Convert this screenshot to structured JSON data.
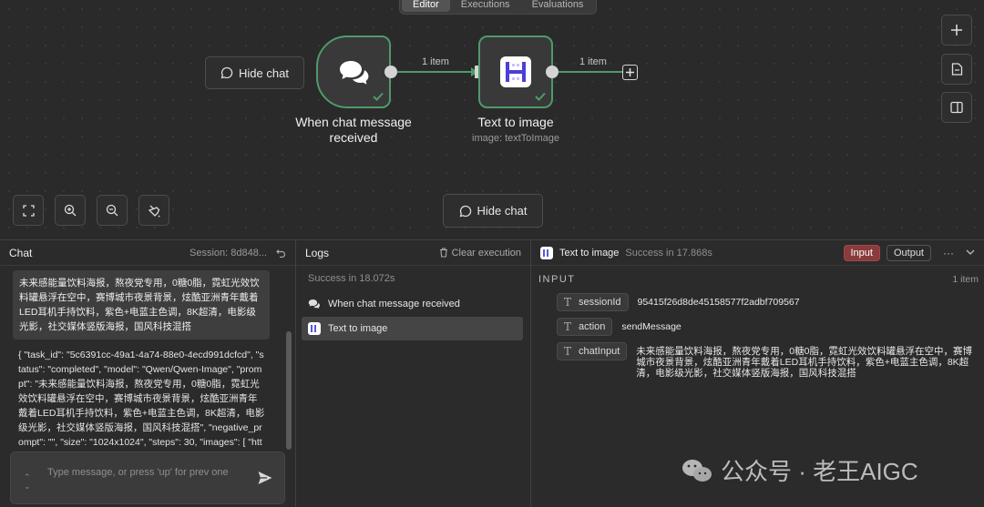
{
  "tabs": [
    "Editor",
    "Executions",
    "Evaluations"
  ],
  "canvas": {
    "hide_chat_label": "Hide chat",
    "nodes": {
      "chat_trigger": {
        "label_line1": "When chat message",
        "label_line2": "received"
      },
      "text_to_image": {
        "label": "Text to image",
        "sub": "image: textToImage"
      }
    },
    "edges": {
      "e1": "1 item",
      "e2": "1 item"
    }
  },
  "chat": {
    "title": "Chat",
    "session": "Session: 8d848...",
    "user_message": "未来感能量饮料海报，熬夜党专用，0糖0脂，霓虹光效饮料罐悬浮在空中，赛博城市夜景背景，炫酷亚洲青年戴着LED耳机手持饮料，紫色+电蓝主色调，8K超清，电影级光影，社交媒体竖版海报，国风科技混搭",
    "response": "{ \"task_id\": \"5c6391cc-49a1-4a74-88e0-4ecd991dcfcd\", \"status\": \"completed\", \"model\": \"Qwen/Qwen-Image\", \"prompt\": \"未来感能量饮料海报，熬夜党专用，0糖0脂，霓虹光效饮料罐悬浮在空中，赛博城市夜景背景，炫酷亚洲青年戴着LED耳机手持饮料，紫色+电蓝主色调，8K超清，电影级光影，社交媒体竖版海报，国风科技混搭\", \"negative_prompt\": \"\", \"size\": \"1024x1024\", \"steps\": 30, \"images\": [ \"http",
    "input_placeholder": "Type message, or press 'up' for prev one"
  },
  "logs": {
    "title": "Logs",
    "clear_label": "Clear execution",
    "status": "Success in 18.072s",
    "items": [
      "When chat message received",
      "Text to image"
    ]
  },
  "detail": {
    "title": "Text to image",
    "status": "Success in 17.868s",
    "input_btn": "Input",
    "output_btn": "Output",
    "section": "INPUT",
    "count": "1 item",
    "params": [
      {
        "key": "sessionId",
        "value": "95415f26d8de45158577f2adbf709567"
      },
      {
        "key": "action",
        "value": "sendMessage"
      },
      {
        "key": "chatInput",
        "value": "未来感能量饮料海报，熬夜党专用，0糖0脂，霓虹光效饮料罐悬浮在空中，赛博城市夜景背景，炫酷亚洲青年戴着LED耳机手持饮料，紫色+电蓝主色调，8K超清，电影级光影，社交媒体竖版海报，国风科技混搭"
      }
    ]
  },
  "watermark": "公众号 · 老王AIGC",
  "colors": {
    "success": "#4f9a6b",
    "input_active": "#8a3b3b"
  }
}
